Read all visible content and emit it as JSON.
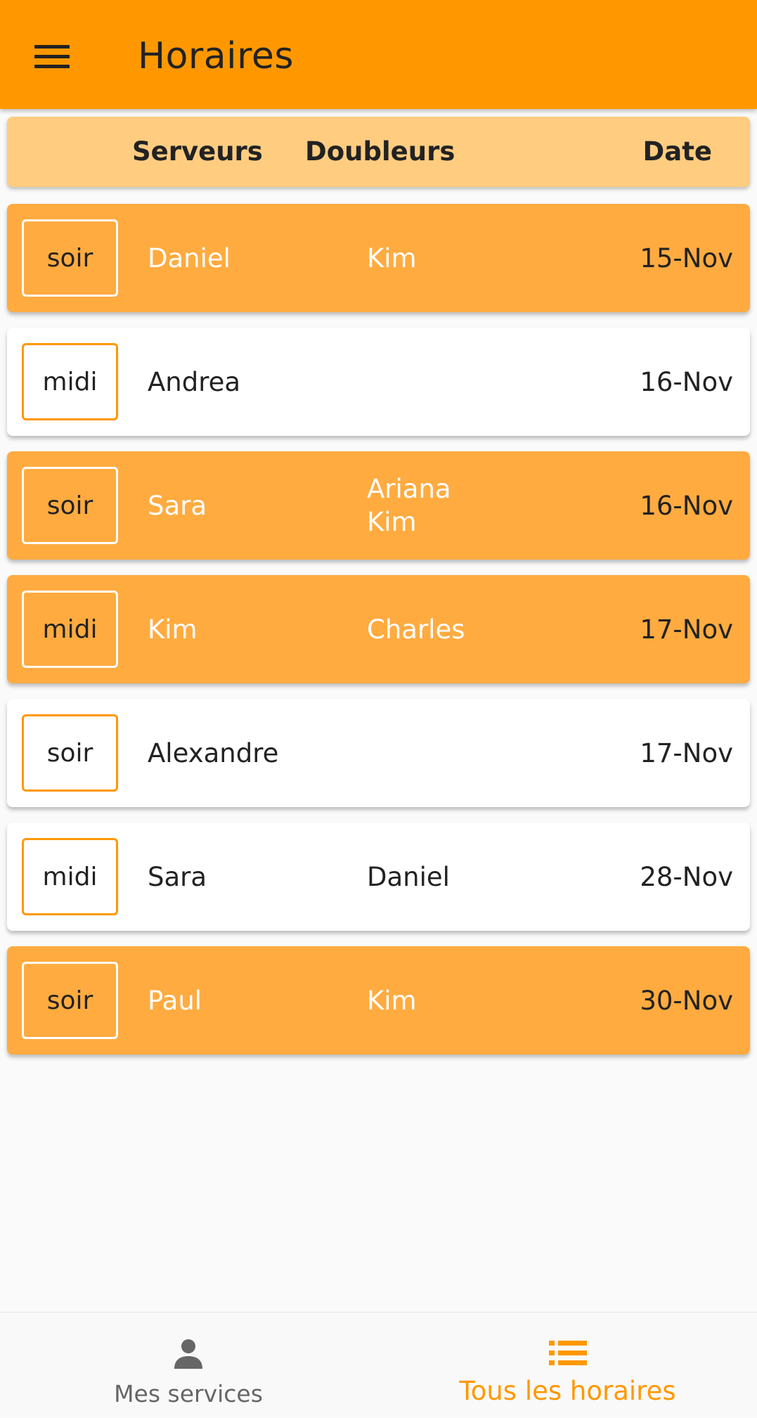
{
  "app_bar": {
    "title": "Horaires",
    "menu_icon": "hamburger-menu-icon"
  },
  "columns": {
    "servers": "Serveurs",
    "doublers": "Doubleurs",
    "date": "Date"
  },
  "schedule": [
    {
      "shift": "soir",
      "server": "Daniel",
      "doublers": [
        "Kim"
      ],
      "date": "15-Nov",
      "highlighted": true
    },
    {
      "shift": "midi",
      "server": "Andrea",
      "doublers": [],
      "date": "16-Nov",
      "highlighted": false
    },
    {
      "shift": "soir",
      "server": "Sara",
      "doublers": [
        "Ariana",
        "Kim"
      ],
      "date": "16-Nov",
      "highlighted": true
    },
    {
      "shift": "midi",
      "server": "Kim",
      "doublers": [
        "Charles"
      ],
      "date": "17-Nov",
      "highlighted": true
    },
    {
      "shift": "soir",
      "server": "Alexandre",
      "doublers": [],
      "date": "17-Nov",
      "highlighted": false
    },
    {
      "shift": "midi",
      "server": "Sara",
      "doublers": [
        "Daniel"
      ],
      "date": "28-Nov",
      "highlighted": false
    },
    {
      "shift": "soir",
      "server": "Paul",
      "doublers": [
        "Kim"
      ],
      "date": "30-Nov",
      "highlighted": true
    }
  ],
  "bottom_nav": {
    "items": [
      {
        "label": "Mes services",
        "icon": "person-icon",
        "active": false
      },
      {
        "label": "Tous les horaires",
        "icon": "list-icon",
        "active": true
      }
    ]
  },
  "colors": {
    "primary": "#ff9800",
    "row_highlight": "#ffab40",
    "header_row": "#ffcc80"
  }
}
